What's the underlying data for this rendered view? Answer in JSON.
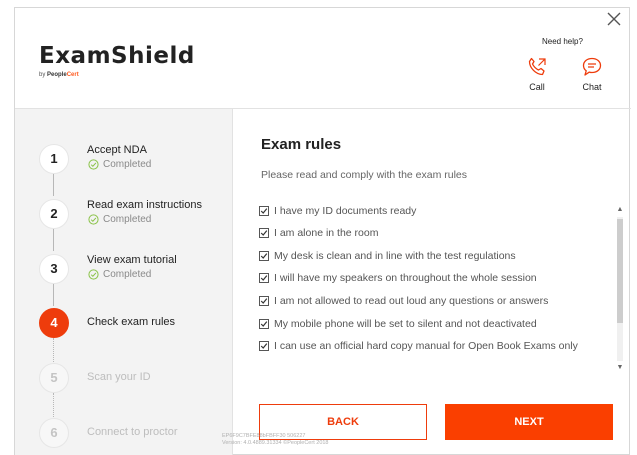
{
  "app": {
    "title": "ExamShield",
    "by_prefix": "by ",
    "by_brand": "People",
    "by_brand_accent": "Cert"
  },
  "help": {
    "title": "Need help?",
    "call_label": "Call",
    "chat_label": "Chat"
  },
  "colors": {
    "accent": "#ee3c0c",
    "next_button": "#fa3f00",
    "check_green": "#8bc34a"
  },
  "steps": [
    {
      "number": "1",
      "title": "Accept NDA",
      "status": "Completed",
      "state": "completed"
    },
    {
      "number": "2",
      "title": "Read exam instructions",
      "status": "Completed",
      "state": "completed"
    },
    {
      "number": "3",
      "title": "View exam tutorial",
      "status": "Completed",
      "state": "completed"
    },
    {
      "number": "4",
      "title": "Check exam rules",
      "status": "",
      "state": "active"
    },
    {
      "number": "5",
      "title": "Scan your ID",
      "status": "",
      "state": "pending"
    },
    {
      "number": "6",
      "title": "Connect to proctor",
      "status": "",
      "state": "pending"
    }
  ],
  "main": {
    "title": "Exam rules",
    "subtitle": "Please read and comply with the exam rules",
    "rules": [
      {
        "text": "I have my ID documents ready",
        "checked": true
      },
      {
        "text": "I am alone in the room",
        "checked": true
      },
      {
        "text": "My desk is clean and in line with the test regulations",
        "checked": true
      },
      {
        "text": "I will have my speakers on throughout the whole session",
        "checked": true
      },
      {
        "text": "I am not allowed to read out loud any questions or answers",
        "checked": true
      },
      {
        "text": "My mobile phone will be set to silent and not deactivated",
        "checked": true
      },
      {
        "text": "I can use an official hard copy manual for Open Book Exams only",
        "checked": true
      }
    ],
    "back_label": "BACK",
    "next_label": "NEXT"
  },
  "footer": {
    "line1": "EP6F9C7BFE88bFBFF30 506227",
    "line2": "Version: 4.0.4889.31334 ©PeopleCert 2018"
  },
  "icons": {
    "close": "close-icon",
    "call": "phone-icon",
    "chat": "chat-bubble-icon",
    "completed": "check-circle-icon",
    "checkbox": "checkbox-checked-icon"
  }
}
